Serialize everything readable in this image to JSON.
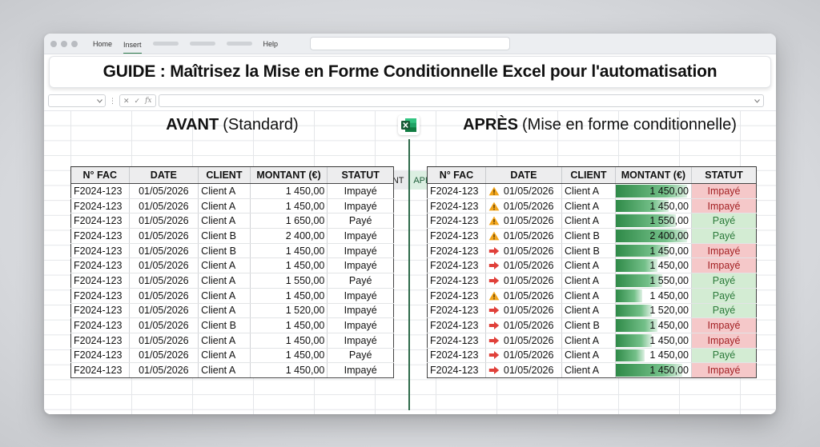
{
  "ribbon": {
    "menu": [
      "Home",
      "Insert",
      "Help"
    ],
    "active": "Insert"
  },
  "title": "GUIDE : Maîtrisez la Mise en Forme Conditionnelle Excel pour l'automatisation",
  "formula": {
    "cancel_icon": "✕",
    "confirm_icon": "✓",
    "fx": "fx"
  },
  "avant": {
    "heading_bold": "AVANT",
    "heading_rest": "(Standard)",
    "toggle": "AVANT"
  },
  "apres": {
    "heading_bold": "APRÈS",
    "heading_rest": "(Mise en forme conditionnelle)",
    "toggle": "APRÈS"
  },
  "columns": [
    "N° FAC",
    "DATE",
    "CLIENT",
    "MONTANT (€)",
    "STATUT"
  ],
  "rows_avant": [
    [
      "F2024-123",
      "01/05/2026",
      "Client A",
      "1 450,00",
      "Impayé"
    ],
    [
      "F2024-123",
      "01/05/2026",
      "Client A",
      "1 450,00",
      "Impayé"
    ],
    [
      "F2024-123",
      "01/05/2026",
      "Client A",
      "1 650,00",
      "Payé"
    ],
    [
      "F2024-123",
      "01/05/2026",
      "Client B",
      "2 400,00",
      "Impayé"
    ],
    [
      "F2024-123",
      "01/05/2026",
      "Client B",
      "1 450,00",
      "Impayé"
    ],
    [
      "F2024-123",
      "01/05/2026",
      "Client A",
      "1 450,00",
      "Impayé"
    ],
    [
      "F2024-123",
      "01/05/2026",
      "Client A",
      "1 550,00",
      "Payé"
    ],
    [
      "F2024-123",
      "01/05/2026",
      "Client A",
      "1 450,00",
      "Impayé"
    ],
    [
      "F2024-123",
      "01/05/2026",
      "Client A",
      "1 520,00",
      "Impayé"
    ],
    [
      "F2024-123",
      "01/05/2026",
      "Client B",
      "1 450,00",
      "Impayé"
    ],
    [
      "F2024-123",
      "01/05/2026",
      "Client A",
      "1 450,00",
      "Impayé"
    ],
    [
      "F2024-123",
      "01/05/2026",
      "Client A",
      "1 450,00",
      "Payé"
    ],
    [
      "F2024-123",
      "01/05/2026",
      "Client A",
      "1 450,00",
      "Impayé"
    ]
  ],
  "rows_apres": [
    {
      "fac": "F2024-123",
      "icon": "warning",
      "date": "01/05/2026",
      "client": "Client A",
      "amount": "1 450,00",
      "bar": 0.95,
      "status": "Impayé"
    },
    {
      "fac": "F2024-123",
      "icon": "warning",
      "date": "01/05/2026",
      "client": "Client A",
      "amount": "1 450,00",
      "bar": 0.7,
      "status": "Impayé"
    },
    {
      "fac": "F2024-123",
      "icon": "warning",
      "date": "01/05/2026",
      "client": "Client A",
      "amount": "1 550,00",
      "bar": 0.8,
      "status": "Payé"
    },
    {
      "fac": "F2024-123",
      "icon": "warning",
      "date": "01/05/2026",
      "client": "Client B",
      "amount": "2 400,00",
      "bar": 0.95,
      "status": "Payé"
    },
    {
      "fac": "F2024-123",
      "icon": "arrow",
      "date": "01/05/2026",
      "client": "Client B",
      "amount": "1 450,00",
      "bar": 0.7,
      "status": "Impayé"
    },
    {
      "fac": "F2024-123",
      "icon": "arrow",
      "date": "01/05/2026",
      "client": "Client A",
      "amount": "1 450,00",
      "bar": 0.55,
      "status": "Impayé"
    },
    {
      "fac": "F2024-123",
      "icon": "arrow",
      "date": "01/05/2026",
      "client": "Client A",
      "amount": "1 550,00",
      "bar": 0.62,
      "status": "Payé"
    },
    {
      "fac": "F2024-123",
      "icon": "warning",
      "date": "01/05/2026",
      "client": "Client A",
      "amount": "1 450,00",
      "bar": 0.35,
      "status": "Payé"
    },
    {
      "fac": "F2024-123",
      "icon": "arrow",
      "date": "01/05/2026",
      "client": "Client A",
      "amount": "1 520,00",
      "bar": 0.48,
      "status": "Payé"
    },
    {
      "fac": "F2024-123",
      "icon": "arrow",
      "date": "01/05/2026",
      "client": "Client B",
      "amount": "1 450,00",
      "bar": 0.55,
      "status": "Impayé"
    },
    {
      "fac": "F2024-123",
      "icon": "arrow",
      "date": "01/05/2026",
      "client": "Client A",
      "amount": "1 450,00",
      "bar": 0.48,
      "status": "Impayé"
    },
    {
      "fac": "F2024-123",
      "icon": "arrow",
      "date": "01/05/2026",
      "client": "Client A",
      "amount": "1 450,00",
      "bar": 0.38,
      "status": "Payé"
    },
    {
      "fac": "F2024-123",
      "icon": "arrow",
      "date": "01/05/2026",
      "client": "Client A",
      "amount": "1 450,00",
      "bar": 0.88,
      "status": "Impayé"
    }
  ],
  "colors": {
    "impaye_bg": "#f5c8c9",
    "paye_bg": "#d3ecd3",
    "databar": "#2f8a48",
    "warning": "#f2a51b",
    "arrow": "#e0403a",
    "excel_green": "#1e7145"
  }
}
